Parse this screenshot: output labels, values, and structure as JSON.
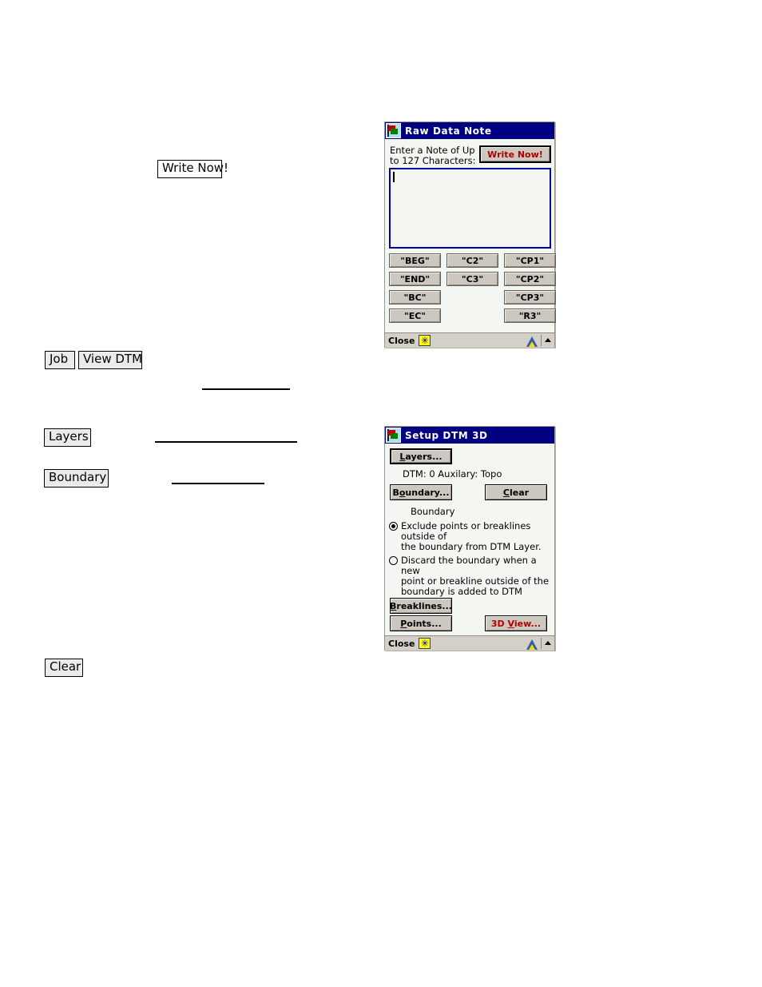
{
  "document": {
    "inline_refs": [
      {
        "label": "Write Now!",
        "name": "doc-ref-write-now"
      },
      {
        "label": "Job",
        "name": "doc-ref-job"
      },
      {
        "label": "View DTM",
        "name": "doc-ref-view-dtm"
      },
      {
        "label": "Layers",
        "name": "doc-ref-layers"
      },
      {
        "label": "Boundary",
        "name": "doc-ref-boundary"
      },
      {
        "label": "Clear",
        "name": "doc-ref-clear"
      }
    ]
  },
  "raw_data_note": {
    "title": "Raw Data Note",
    "prompt": "Enter a Note of Up\nto 127 Characters:",
    "write_now_label": "Write Now!",
    "note_value": "",
    "note_placeholder": "",
    "code_buttons": [
      "\"BEG\"",
      "\"C2\"",
      "\"CP1\"",
      "\"END\"",
      "\"C3\"",
      "\"CP2\"",
      "\"BC\"",
      "\"CP3\"",
      "\"EC\"",
      "\"R3\""
    ],
    "status": {
      "close_label": "Close"
    }
  },
  "setup_dtm_3d": {
    "title": "Setup DTM 3D",
    "layers_label": "Layers...",
    "layer_status": "DTM: 0 Auxilary: Topo",
    "boundary_label": "Boundary...",
    "clear_label": "Clear",
    "boundary_group_label": "Boundary",
    "options": [
      {
        "text": "Exclude points or breaklines outside of\nthe boundary from DTM Layer.",
        "selected": true
      },
      {
        "text": "Discard the boundary when a new\npoint or breakline outside of the\nboundary is added to DTM Layer.",
        "selected": false
      }
    ],
    "breaklines_label": "Breaklines...",
    "points_label": "Points...",
    "view3d_label": "3D View...",
    "status": {
      "close_label": "Close"
    }
  },
  "colors": {
    "titlebar": "#000080",
    "window_face": "#d4d0c8",
    "client": "#f4f7f1",
    "accent_red": "#b00000",
    "field_border": "#0000a0"
  }
}
